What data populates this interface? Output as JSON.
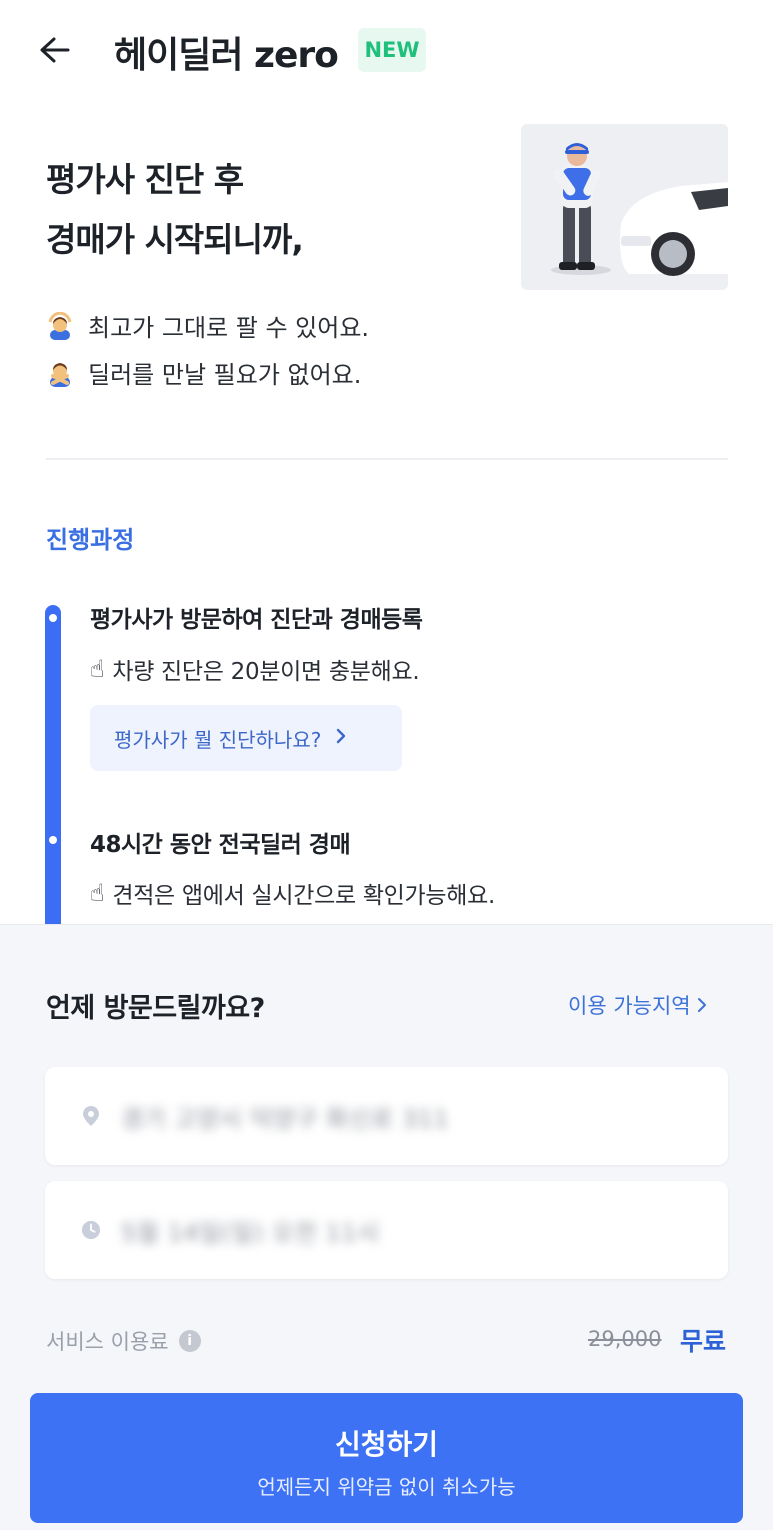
{
  "header": {
    "title": "헤이딜러 zero",
    "badge": "NEW"
  },
  "hero": {
    "title_line1": "평가사 진단 후",
    "title_line2": "경매가 시작되니까,"
  },
  "benefits": [
    {
      "icon": "person-gesturing-ok-icon",
      "text": "최고가 그대로 팔 수 있어요."
    },
    {
      "icon": "person-gesturing-no-icon",
      "text": "딜러를 만날 필요가 없어요."
    }
  ],
  "process": {
    "section_title": "진행과정",
    "steps": [
      {
        "title": "평가사가 방문하여 진단과 경매등록",
        "desc": "차량 진단은 20분이면 충분해요.",
        "help_button": "평가사가 뭘 진단하나요?"
      },
      {
        "title": "48시간 동안 전국딜러 경매",
        "desc": "견적은 앱에서 실시간으로 확인가능해요."
      }
    ]
  },
  "booking": {
    "title": "언제 방문드릴까요?",
    "region_link": "이용 가능지역",
    "address_value": "경기 고양시 덕양구 화신로 311",
    "datetime_value": "5월 14일(일) 오전 11시",
    "fee_label": "서비스 이용료",
    "fee_original": "29,000",
    "fee_free": "무료",
    "apply_label": "신청하기",
    "apply_sub": "언제든지 위약금 없이 취소가능"
  },
  "colors": {
    "accent": "#3d72f5",
    "badge_green": "#1fbf7c",
    "section_blue": "#3a6fe4"
  }
}
